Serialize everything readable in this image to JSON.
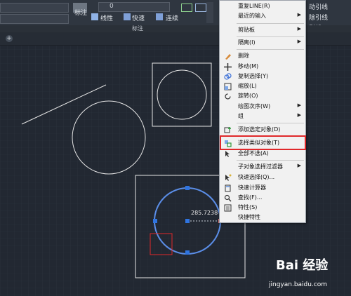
{
  "ribbon": {
    "annotate_label": "标注",
    "linear_label": "线性",
    "quick_label": "快速",
    "continue_label": "连续",
    "panel_label": "标注",
    "dropdown_value": "0",
    "right_text_1": "动引线",
    "right_text_2": "除引线",
    "right_text_3": "引线"
  },
  "drawing": {
    "dimension_value": "285.7238"
  },
  "context_menu": {
    "items": [
      {
        "label": "重复LINE(R)",
        "submenu": false
      },
      {
        "label": "最近的输入",
        "submenu": true
      },
      {
        "label": "剪贴板",
        "submenu": true
      },
      {
        "label": "隔离(I)",
        "submenu": true
      },
      {
        "label": "删除",
        "submenu": false
      },
      {
        "label": "移动(M)",
        "submenu": false
      },
      {
        "label": "复制选择(Y)",
        "submenu": false
      },
      {
        "label": "缩放(L)",
        "submenu": false
      },
      {
        "label": "旋转(O)",
        "submenu": false
      },
      {
        "label": "绘图次序(W)",
        "submenu": true
      },
      {
        "label": "组",
        "submenu": true
      },
      {
        "label": "添加选定对象(D)",
        "submenu": false
      },
      {
        "label": "选择类似对象(T)",
        "submenu": false
      },
      {
        "label": "全部不选(A)",
        "submenu": false
      },
      {
        "label": "子对象选择过滤器",
        "submenu": true
      },
      {
        "label": "快速选择(Q)...",
        "submenu": false
      },
      {
        "label": "快速计算器",
        "submenu": false
      },
      {
        "label": "查找(F)...",
        "submenu": false
      },
      {
        "label": "特性(S)",
        "submenu": false
      },
      {
        "label": "快捷特性",
        "submenu": false
      }
    ]
  },
  "watermark": {
    "brand": "Bai 经验",
    "url": "jingyan.baidu.com"
  },
  "colors": {
    "canvas": "#222832",
    "selection": "#5b8ee8",
    "highlight": "#e0282a"
  }
}
